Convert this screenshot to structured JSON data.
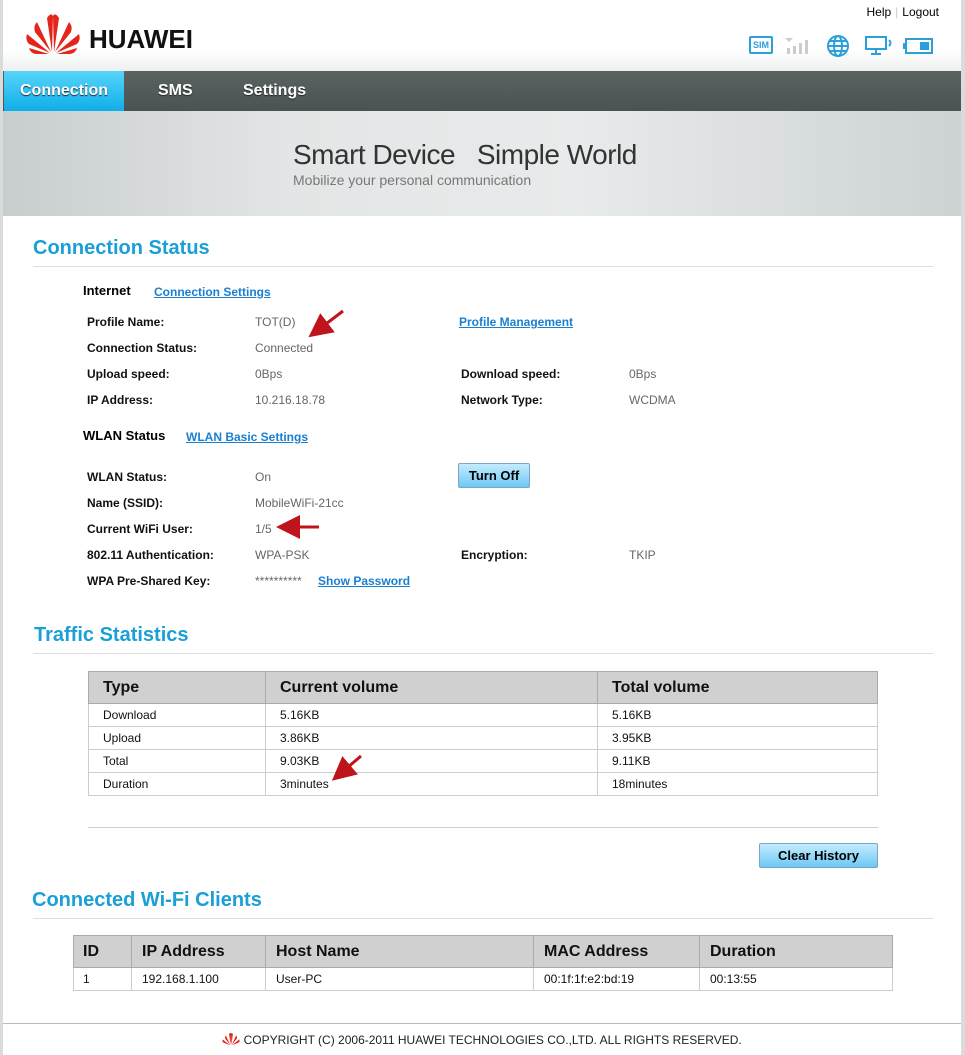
{
  "header": {
    "brand": "HUAWEI",
    "help": "Help",
    "logout": "Logout",
    "status_icons": [
      "sim-icon",
      "signal-strength-icon",
      "internet-globe-icon",
      "wifi-device-icon",
      "battery-icon"
    ],
    "sim_label": "SIM"
  },
  "nav": {
    "tabs": [
      {
        "label": "Connection",
        "active": true
      },
      {
        "label": "SMS"
      },
      {
        "label": "Settings"
      }
    ]
  },
  "banner": {
    "title": "Smart Device   Simple World",
    "subtitle": "Mobilize your personal communication"
  },
  "connection_status": {
    "title": "Connection Status",
    "internet": {
      "title": "Internet",
      "settings_link": "Connection Settings",
      "profile_link": "Profile Management",
      "profile_name_label": "Profile Name:",
      "profile_name": "TOT(D)",
      "conn_status_label": "Connection Status:",
      "conn_status": "Connected",
      "upload_label": "Upload speed:",
      "upload": "0Bps",
      "download_label": "Download speed:",
      "download": "0Bps",
      "ip_label": "IP Address:",
      "ip": "10.216.18.78",
      "network_label": "Network Type:",
      "network": "WCDMA"
    },
    "wlan": {
      "title": "WLAN Status",
      "settings_link": "WLAN Basic Settings",
      "turn_off": "Turn Off",
      "status_label": "WLAN Status:",
      "status": "On",
      "ssid_label": "Name (SSID):",
      "ssid": "MobileWiFi-21cc",
      "users_label": "Current WiFi User:",
      "users": "1/5",
      "auth_label": "802.11 Authentication:",
      "auth": "WPA-PSK",
      "enc_label": "Encryption:",
      "enc": "TKIP",
      "key_label": "WPA Pre-Shared Key:",
      "key": "**********",
      "show_password": "Show Password"
    }
  },
  "traffic": {
    "title": "Traffic Statistics",
    "headers": [
      "Type",
      "Current volume",
      "Total volume"
    ],
    "rows": [
      [
        "Download",
        "5.16KB",
        "5.16KB"
      ],
      [
        "Upload",
        "3.86KB",
        "3.95KB"
      ],
      [
        "Total",
        "9.03KB",
        "9.11KB"
      ],
      [
        "Duration",
        "3minutes",
        "18minutes"
      ]
    ],
    "clear_history": "Clear History"
  },
  "clients": {
    "title": "Connected Wi-Fi Clients",
    "headers": [
      "ID",
      "IP Address",
      "Host Name",
      "MAC Address",
      "Duration"
    ],
    "rows": [
      [
        "1",
        "192.168.1.100",
        "User-PC",
        "00:1f:1f:e2:bd:19",
        "00:13:55"
      ]
    ]
  },
  "footer": {
    "copyright": "COPYRIGHT (C) 2006-2011 HUAWEI TECHNOLOGIES CO.,LTD. ALL RIGHTS RESERVED."
  },
  "colors": {
    "accent": "#1a9fd6",
    "link": "#1a7fd0",
    "annotation": "#c0141c",
    "brand": "#e4251b"
  }
}
